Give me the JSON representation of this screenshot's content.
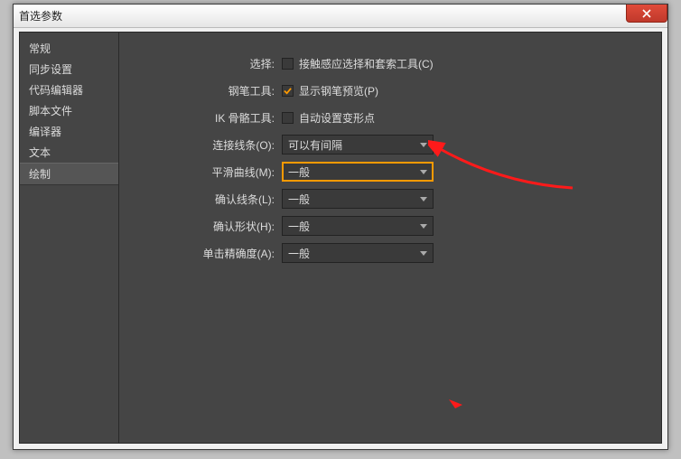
{
  "window": {
    "title": "首选参数"
  },
  "sidebar": {
    "items": [
      {
        "label": "常规"
      },
      {
        "label": "同步设置"
      },
      {
        "label": "代码编辑器"
      },
      {
        "label": "脚本文件"
      },
      {
        "label": "编译器"
      },
      {
        "label": "文本"
      },
      {
        "label": "绘制"
      }
    ],
    "selectedIndex": 6
  },
  "form": {
    "select_label": "选择:",
    "select_check_text": "接触感应选择和套索工具(C)",
    "pen_label": "钢笔工具:",
    "pen_check_text": "显示钢笔预览(P)",
    "ik_label": "IK 骨骼工具:",
    "ik_check_text": "自动设置变形点",
    "connect_label": "连接线条(O):",
    "connect_value": "可以有间隔",
    "smooth_label": "平滑曲线(M):",
    "smooth_value": "一般",
    "confirm_line_label": "确认线条(L):",
    "confirm_line_value": "一般",
    "confirm_shape_label": "确认形状(H):",
    "confirm_shape_value": "一般",
    "click_label": "单击精确度(A):",
    "click_value": "一般"
  }
}
